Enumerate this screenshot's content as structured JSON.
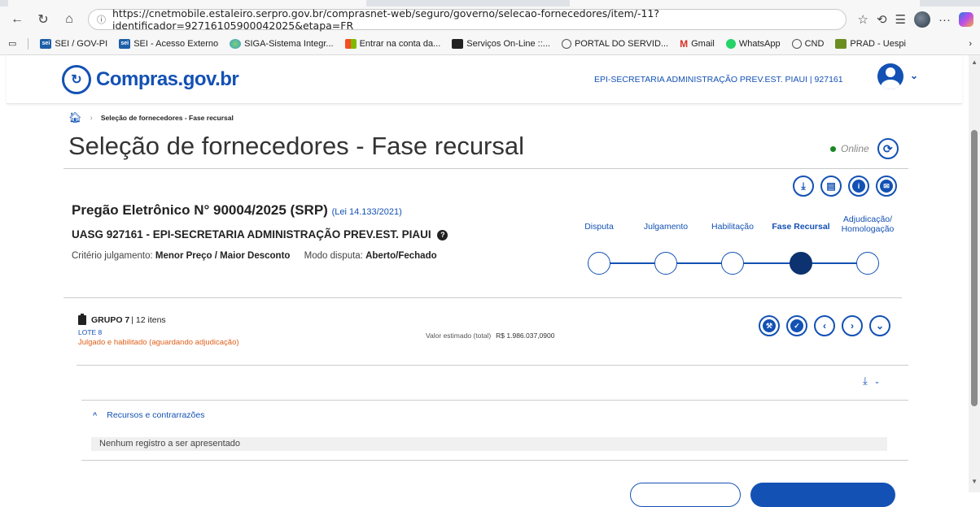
{
  "browser": {
    "url": "https://cnetmobile.estaleiro.serpro.gov.br/comprasnet-web/seguro/governo/selecao-fornecedores/item/-11?identificador=92716105900042025&etapa=FR",
    "bookmarks": [
      {
        "label": "SEI / GOV-PI",
        "icon": "sei-icon"
      },
      {
        "label": "SEI - Acesso Externo",
        "icon": "sei-icon"
      },
      {
        "label": "SIGA-Sistema Integr...",
        "icon": "siga-icon"
      },
      {
        "label": "Entrar na conta da...",
        "icon": "microsoft-icon"
      },
      {
        "label": "Serviços On-Line ::...",
        "icon": "servicos-icon"
      },
      {
        "label": "PORTAL DO SERVID...",
        "icon": "globe-icon"
      },
      {
        "label": "Gmail",
        "icon": "gmail-icon"
      },
      {
        "label": "WhatsApp",
        "icon": "whatsapp-icon"
      },
      {
        "label": "CND",
        "icon": "globe-icon"
      },
      {
        "label": "PRAD - Uespi",
        "icon": "prad-icon"
      }
    ]
  },
  "header": {
    "logo_text": "Compras.gov.br",
    "org_label": "EPI-SECRETARIA ADMINISTRAÇÃO PREV.EST. PIAUI | 927161"
  },
  "breadcrumb": {
    "current": "Seleção de fornecedores - Fase recursal"
  },
  "page": {
    "title": "Seleção de fornecedores - Fase recursal",
    "online_label": "Online"
  },
  "pregao": {
    "title": "Pregão Eletrônico N° 90004/2025 (SRP)",
    "lei_link": "(Lei 14.133/2021)",
    "uasg": "UASG 927161 - EPI-SECRETARIA ADMINISTRAÇÃO PREV.EST. PIAUI",
    "criterio_label": "Critério julgamento:",
    "criterio_value": "Menor Preço / Maior Desconto",
    "modo_label": "Modo disputa:",
    "modo_value": "Aberto/Fechado"
  },
  "steps": [
    {
      "label": "Disputa",
      "label2": "",
      "active": false
    },
    {
      "label": "Julgamento",
      "label2": "",
      "active": false
    },
    {
      "label": "Habilitação",
      "label2": "",
      "active": false
    },
    {
      "label": "Fase Recursal",
      "label2": "",
      "active": true
    },
    {
      "label": "Adjudicação/",
      "label2": "Homologação",
      "active": false
    }
  ],
  "grupo": {
    "title": "GRUPO 7",
    "itens": "| 12 itens",
    "lote": "LOTE 8",
    "status": "Julgado e habilitado (aguardando adjudicação)",
    "valor_label": "Valor estimado (total)",
    "valor_value": "R$ 1.986.037,0900"
  },
  "recursos": {
    "title": "Recursos e contrarrazões",
    "empty": "Nenhum registro a ser apresentado"
  },
  "colors": {
    "primary": "#1351b4",
    "active_step": "#0c326f",
    "status_orange": "#e0601b",
    "online_green": "#168821"
  }
}
